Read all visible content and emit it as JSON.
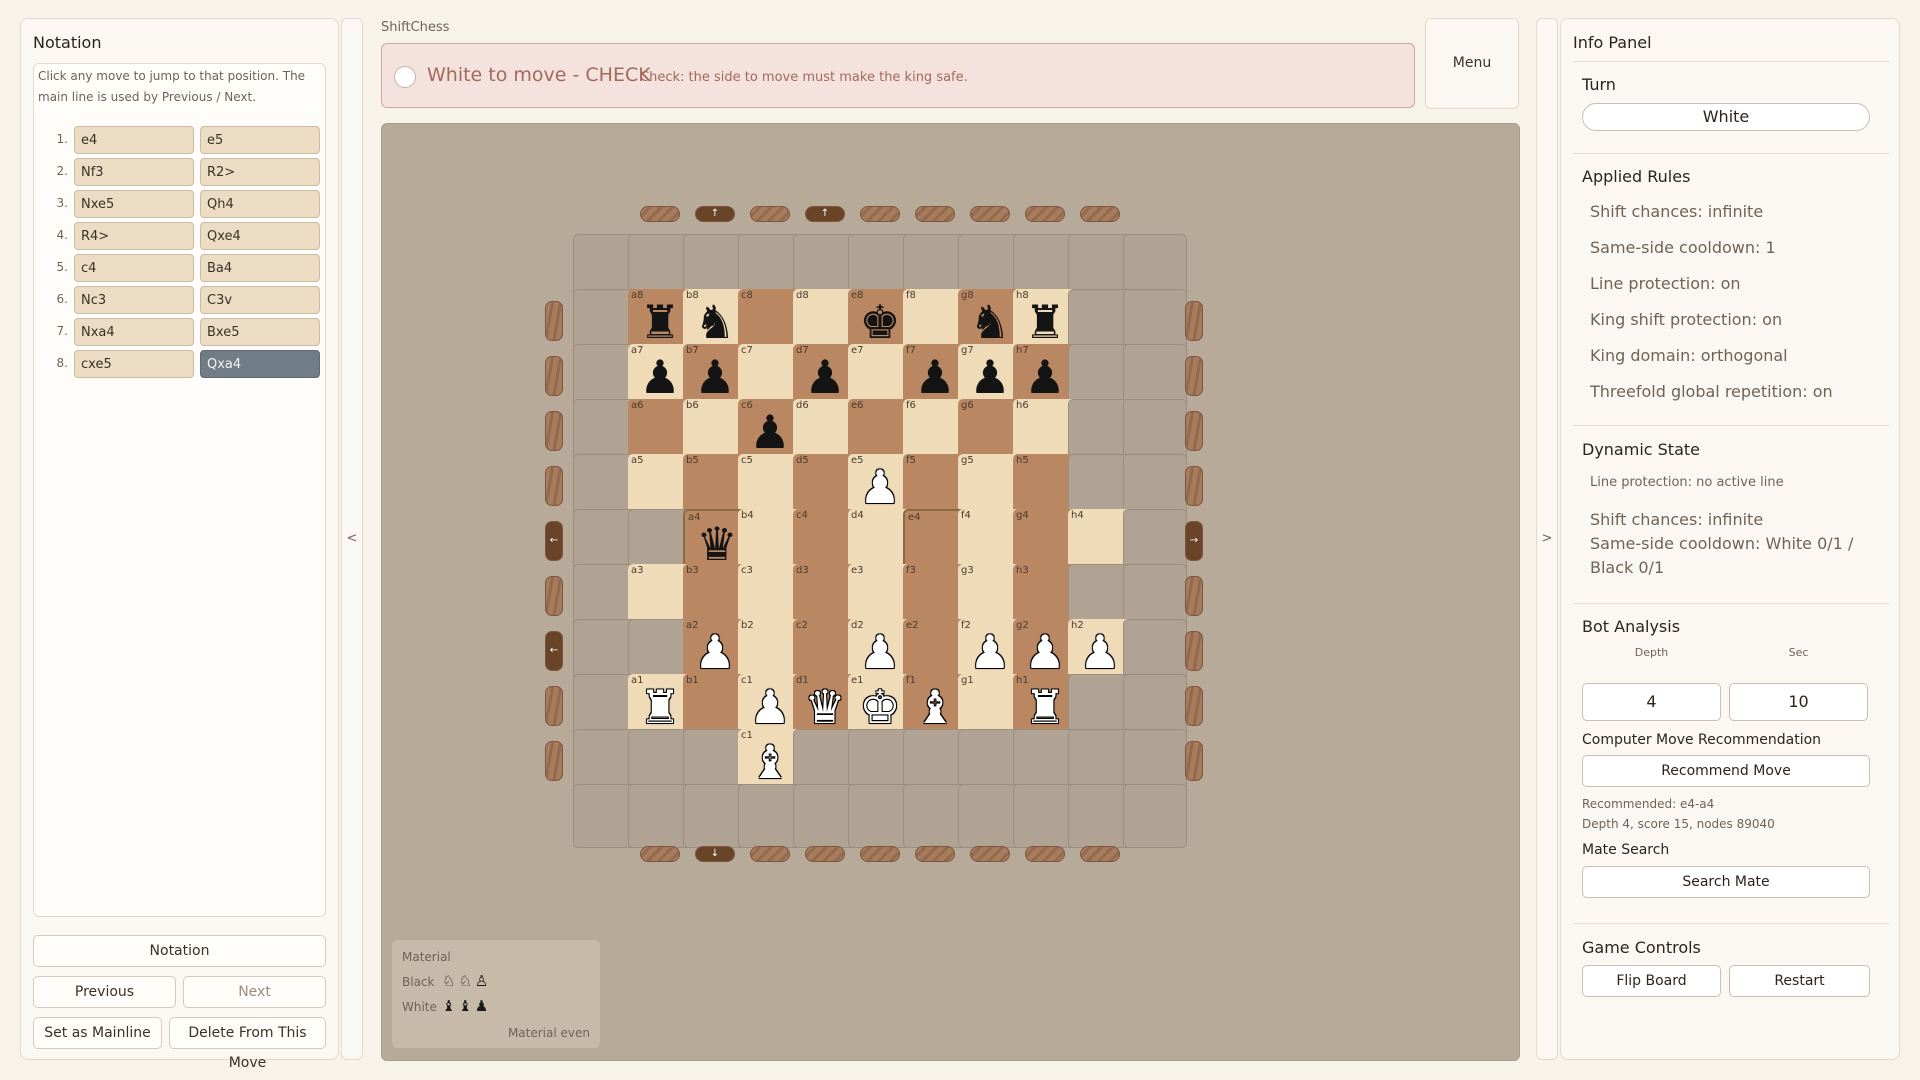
{
  "notation": {
    "title": "Notation",
    "help": "Click any move to jump to that position. The main line is used by Previous / Next.",
    "moves": [
      {
        "num": "1.",
        "white": "e4",
        "black": "e5"
      },
      {
        "num": "2.",
        "white": "Nf3",
        "black": "R2>"
      },
      {
        "num": "3.",
        "white": "Nxe5",
        "black": "Qh4"
      },
      {
        "num": "4.",
        "white": "R4>",
        "black": "Qxe4"
      },
      {
        "num": "5.",
        "white": "c4",
        "black": "Ba4"
      },
      {
        "num": "6.",
        "white": "Nc3",
        "black": "C3v"
      },
      {
        "num": "7.",
        "white": "Nxa4",
        "black": "Bxe5"
      },
      {
        "num": "8.",
        "white": "cxe5",
        "black": "Qxa4"
      }
    ],
    "active_move": "8-black",
    "buttons": {
      "notation": "Notation",
      "previous": "Previous",
      "next": "Next",
      "mainline": "Set as Mainline",
      "delete": "Delete From This Move"
    }
  },
  "collapse": {
    "left": "<",
    "right": ">"
  },
  "app_title": "ShiftChess",
  "status": {
    "main": "White to move - CHECK",
    "sub": "Check: the side to move must make the king safe."
  },
  "menu_label": "Menu",
  "board": {
    "files": [
      "a",
      "b",
      "c",
      "d",
      "e",
      "f",
      "g",
      "h"
    ],
    "rows": [
      {
        "rank": "8",
        "offset": 1,
        "pieces": [
          "bR",
          "bN",
          "",
          "",
          "bK",
          "",
          "bN",
          "bR"
        ]
      },
      {
        "rank": "7",
        "offset": 1,
        "pieces": [
          "bP",
          "bP",
          "",
          "bP",
          "",
          "bP",
          "bP",
          "bP"
        ]
      },
      {
        "rank": "6",
        "offset": 1,
        "pieces": [
          "",
          "",
          "bP",
          "",
          "",
          "",
          "",
          ""
        ]
      },
      {
        "rank": "5",
        "offset": 1,
        "pieces": [
          "",
          "",
          "",
          "",
          "wP",
          "",
          "",
          ""
        ]
      },
      {
        "rank": "4",
        "offset": 2,
        "pieces": [
          "bQ",
          "",
          "",
          "",
          "",
          "",
          "",
          ""
        ]
      },
      {
        "rank": "3",
        "offset": 1,
        "pieces": [
          "",
          "",
          "",
          "",
          "",
          "",
          "",
          ""
        ]
      },
      {
        "rank": "2",
        "offset": 2,
        "pieces": [
          "wP",
          "",
          "",
          "wP",
          "",
          "wP",
          "wP",
          "wP"
        ]
      },
      {
        "rank": "1",
        "offset": 1,
        "pieces": [
          "wR",
          "",
          "wP",
          "wQ",
          "wK",
          "wB",
          "",
          "wR"
        ]
      },
      {
        "rank": "extra",
        "offset": 3,
        "pieces": [
          "wB"
        ],
        "labels": [
          "c1"
        ]
      }
    ],
    "highlight": [
      "a4",
      "e4"
    ],
    "shift_top": [
      "",
      "↑",
      "",
      "↑",
      "",
      "",
      "",
      "",
      ""
    ],
    "shift_bottom": [
      "",
      "↓",
      "",
      "",
      "",
      "",
      "",
      "",
      ""
    ],
    "shift_left": [
      "",
      "",
      "",
      "",
      "←",
      "",
      "←",
      "",
      ""
    ],
    "shift_right": [
      "",
      "",
      "",
      "",
      "→",
      "",
      "",
      "",
      ""
    ]
  },
  "material": {
    "title": "Material",
    "black_label": "Black",
    "black_pieces": "♘♘♙",
    "white_label": "White",
    "white_pieces": "♝♝♟",
    "balance": "Material even"
  },
  "info": {
    "title": "Info Panel",
    "turn_label": "Turn",
    "turn_value": "White",
    "rules_label": "Applied Rules",
    "rules": [
      "Shift chances: infinite",
      "Same-side cooldown: 1",
      "Line protection: on",
      "King shift protection: on",
      "King domain: orthogonal",
      "Threefold global repetition: on"
    ],
    "dynamic_label": "Dynamic State",
    "line_protection": "Line protection: no active line",
    "shift_chances": "Shift chances: infinite",
    "cooldown_1": "Same-side cooldown: White 0/1 /",
    "cooldown_2": "Black 0/1",
    "bot_label": "Bot Analysis",
    "depth_label": "Depth",
    "depth_value": "4",
    "sec_label": "Sec",
    "sec_value": "10",
    "recommend_label": "Computer Move Recommendation",
    "recommend_button": "Recommend Move",
    "recommended": "Recommended: e4-a4",
    "stats": "Depth 4, score 15, nodes 89040",
    "mate_label": "Mate Search",
    "mate_button": "Search Mate",
    "controls_label": "Game Controls",
    "flip_button": "Flip Board",
    "restart_button": "Restart"
  }
}
